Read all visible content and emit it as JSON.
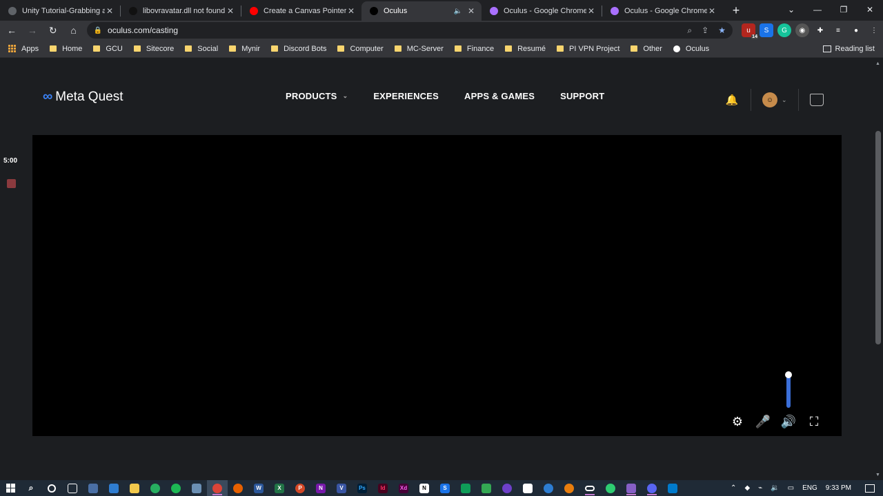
{
  "browser": {
    "tabs": [
      {
        "title": "Unity Tutorial-Grabbing an",
        "favicon_color": "#5f6368",
        "active": false,
        "muted": false
      },
      {
        "title": "libovravatar.dll not found -",
        "favicon_color": "#111111",
        "active": false,
        "muted": false
      },
      {
        "title": "Create a Canvas Pointer in I",
        "favicon_color": "#ff0000",
        "active": false,
        "muted": false
      },
      {
        "title": "Oculus",
        "favicon_color": "#000000",
        "active": true,
        "muted": true
      },
      {
        "title": "Oculus - Google Chrome -",
        "favicon_color": "#a970ff",
        "active": false,
        "muted": false
      },
      {
        "title": "Oculus - Google Chrome -",
        "favicon_color": "#a970ff",
        "active": false,
        "muted": false
      }
    ],
    "url": "oculus.com/casting",
    "bookmarks": [
      {
        "label": "Apps",
        "type": "apps"
      },
      {
        "label": "Home",
        "type": "folder"
      },
      {
        "label": "GCU",
        "type": "folder"
      },
      {
        "label": "Sitecore",
        "type": "folder"
      },
      {
        "label": "Social",
        "type": "folder"
      },
      {
        "label": "Mynir",
        "type": "folder"
      },
      {
        "label": "Discord Bots",
        "type": "folder"
      },
      {
        "label": "Computer",
        "type": "folder"
      },
      {
        "label": "MC-Server",
        "type": "folder"
      },
      {
        "label": "Finance",
        "type": "folder"
      },
      {
        "label": "Resumé",
        "type": "folder"
      },
      {
        "label": "PI VPN Project",
        "type": "folder"
      },
      {
        "label": "Other",
        "type": "folder"
      },
      {
        "label": "Oculus",
        "type": "oculus"
      }
    ],
    "reading_list": "Reading list",
    "extension_badge": "14"
  },
  "site": {
    "logo_text": "Meta Quest",
    "nav": [
      {
        "label": "PRODUCTS",
        "has_dropdown": true
      },
      {
        "label": "EXPERIENCES",
        "has_dropdown": false
      },
      {
        "label": "APPS & GAMES",
        "has_dropdown": false
      },
      {
        "label": "SUPPORT",
        "has_dropdown": false
      }
    ]
  },
  "cast": {
    "timer": "5:00",
    "volume_level": 0.95
  },
  "taskbar": {
    "language": "ENG",
    "time": "9:33 PM"
  }
}
